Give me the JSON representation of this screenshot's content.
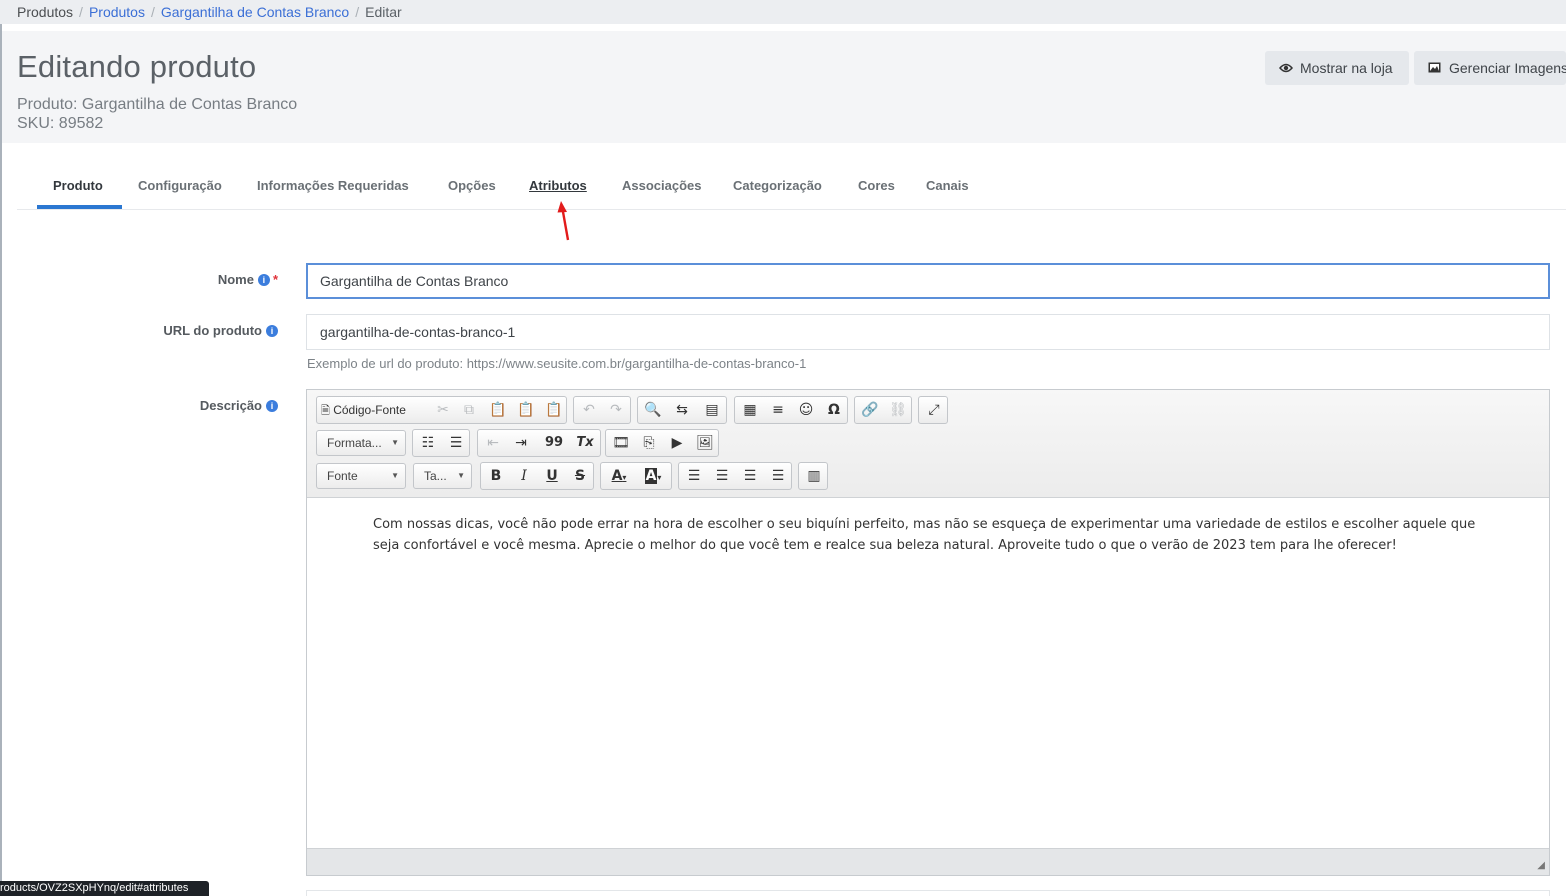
{
  "breadcrumb": {
    "items": [
      "Produtos",
      "Produtos",
      "Gargantilha de Contas Branco",
      "Editar"
    ],
    "separator": "/"
  },
  "header": {
    "title": "Editando produto",
    "product_line": "Produto: Gargantilha de Contas Branco",
    "sku_line": "SKU: 89582",
    "buttons": {
      "show_store": "Mostrar na loja",
      "manage_images": "Gerenciar Imagens"
    }
  },
  "tabs": [
    {
      "label": "Produto"
    },
    {
      "label": "Configuração"
    },
    {
      "label": "Informações Requeridas"
    },
    {
      "label": "Opções"
    },
    {
      "label": "Atributos"
    },
    {
      "label": "Associações"
    },
    {
      "label": "Categorização"
    },
    {
      "label": "Cores"
    },
    {
      "label": "Canais"
    }
  ],
  "form": {
    "name": {
      "label": "Nome",
      "value": "Gargantilha de Contas Branco",
      "required_mark": "*",
      "info": "i"
    },
    "url": {
      "label": "URL do produto",
      "value": "gargantilha-de-contas-branco-1",
      "help": "Exemplo de url do produto: https://www.seusite.com.br/gargantilha-de-contas-branco-1",
      "info": "i"
    },
    "description": {
      "label": "Descrição",
      "info": "i"
    }
  },
  "editor": {
    "source_label": "Código-Fonte",
    "format_label": "Formata...",
    "font_label": "Fonte",
    "size_label": "Ta...",
    "glyphs": {
      "bold": "B",
      "italic": "I",
      "underline": "U",
      "strike": "S",
      "quote": "99",
      "omega": "Ω",
      "smile": "☺",
      "textcolor": "A",
      "bgcolor": "A",
      "clear": "Tx"
    },
    "content": "Com nossas dicas, você não pode errar na hora de escolher o seu biquíni perfeito, mas não se esqueça de experimentar uma variedade de estilos e escolher aquele que seja confortável e você mesma. Aprecie o melhor do que você tem e realce sua beleza natural. Aproveite tudo o que o verão de 2023 tem para lhe oferecer!"
  },
  "status_bar": {
    "url": "roducts/OVZ2SXpHYnq/edit#attributes"
  },
  "colors": {
    "accent": "#2b77d1",
    "link": "#3b6fd6",
    "annotation_arrow": "#e21b1b"
  }
}
